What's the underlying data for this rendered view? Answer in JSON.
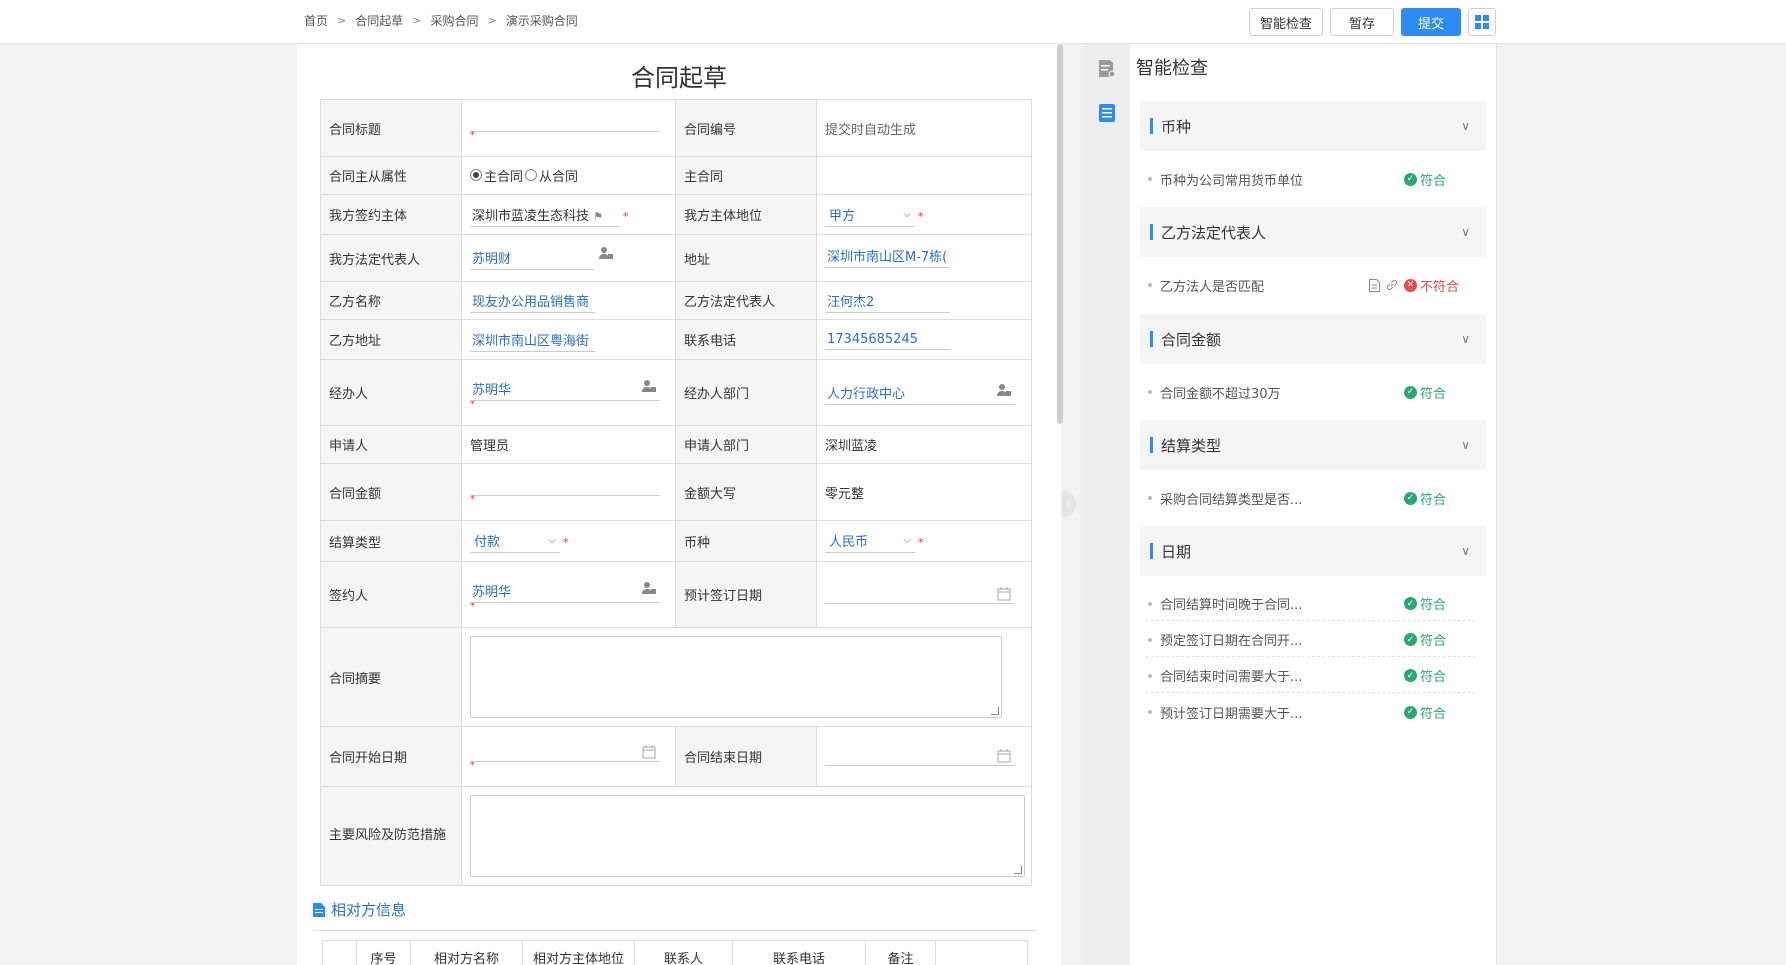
{
  "breadcrumb": [
    "首页",
    "合同起草",
    "采购合同",
    "演示采购合同"
  ],
  "breadcrumb_sep": ">",
  "actions": {
    "check": "智能检查",
    "save": "暂存",
    "submit": "提交"
  },
  "form": {
    "title": "合同起草",
    "labels": {
      "title": "合同标题",
      "number": "合同编号",
      "master": "合同主从属性",
      "master_val": "主合同",
      "signer_entity": "我方签约主体",
      "position": "我方主体地位",
      "legal_rep": "我方法定代表人",
      "address": "地址",
      "b_name": "乙方名称",
      "b_legal": "乙方法定代表人",
      "b_address": "乙方地址",
      "phone": "联系电话",
      "handler": "经办人",
      "handler_dept": "经办人部门",
      "applicant": "申请人",
      "applicant_dept": "申请人部门",
      "amount": "合同金额",
      "amount_upper": "金额大写",
      "settle": "结算类型",
      "currency": "币种",
      "signatory": "签约人",
      "plan_date": "预计签订日期",
      "summary": "合同摘要",
      "start_date": "合同开始日期",
      "end_date": "合同结束日期",
      "risk": "主要风险及防范措施"
    },
    "values": {
      "number": "提交时自动生成",
      "radio_main": "主合同",
      "radio_sub": "从合同",
      "signer_entity": "深圳市蓝凌生态科技",
      "position": "甲方",
      "legal_rep": "苏明财",
      "address": "深圳市南山区M-7栋(",
      "b_name": "现友办公用品销售商",
      "b_legal": "汪何杰2",
      "b_address": "深圳市南山区粤海街",
      "phone": "17345685245",
      "handler": "苏明华",
      "handler_dept": "人力行政中心",
      "applicant": "管理员",
      "applicant_dept": "深圳蓝凌",
      "amount_upper": "零元整",
      "settle": "付款",
      "currency": "人民币",
      "signatory": "苏明华"
    },
    "required_mark": "*"
  },
  "party_section": {
    "title": "相对方信息",
    "columns": [
      "序号",
      "相对方名称",
      "相对方主体地位",
      "联系人",
      "联系电话",
      "备注"
    ]
  },
  "check_panel": {
    "title": "智能检查",
    "groups": [
      {
        "name": "币种",
        "items": [
          {
            "text": "币种为公司常用货币单位",
            "status": "符合"
          }
        ]
      },
      {
        "name": "乙方法定代表人",
        "items": [
          {
            "text": "乙方法人是否匹配",
            "status": "不符合"
          }
        ]
      },
      {
        "name": "合同金额",
        "items": [
          {
            "text": "合同金额不超过30万",
            "status": "符合"
          }
        ]
      },
      {
        "name": "结算类型",
        "items": [
          {
            "text": "采购合同结算类型是否...",
            "status": "符合"
          }
        ]
      },
      {
        "name": "日期",
        "items": [
          {
            "text": "合同结算时间晚于合同...",
            "status": "符合"
          },
          {
            "text": "预定签订日期在合同开...",
            "status": "符合"
          },
          {
            "text": "合同结束时间需要大于...",
            "status": "符合"
          },
          {
            "text": "预计签订日期需要大于...",
            "status": "符合"
          }
        ]
      }
    ]
  },
  "colors": {
    "primary": "#2d8cf0",
    "link": "#2d6fc1",
    "pass": "#2aa870",
    "fail": "#e84c4c"
  },
  "icons": [
    "person-picker-icon",
    "calendar-icon",
    "tag-icon",
    "chevron-down-icon",
    "document-icon",
    "link-icon",
    "check-circle-icon",
    "close-circle-icon",
    "grid-icon",
    "list-icon",
    "report-icon"
  ]
}
